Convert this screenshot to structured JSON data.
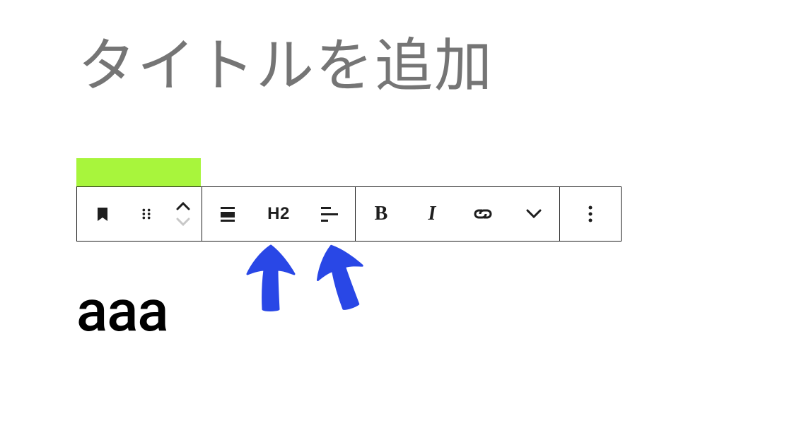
{
  "title": {
    "placeholder": "タイトルを追加",
    "value": ""
  },
  "toolbar": {
    "bookmark_icon": "bookmark",
    "drag_icon": "drag-handle",
    "move_up_icon": "chevron-up",
    "move_down_icon": "chevron-down",
    "align_icon": "align",
    "heading_label": "H2",
    "text_align_icon": "text-align-left",
    "bold_label": "B",
    "italic_label": "I",
    "link_icon": "link",
    "more_inline_icon": "chevron-down",
    "options_icon": "more-vertical"
  },
  "heading_block": {
    "content": "aaa"
  },
  "colors": {
    "marker": "#a8f53c",
    "arrow": "#2947e6"
  }
}
